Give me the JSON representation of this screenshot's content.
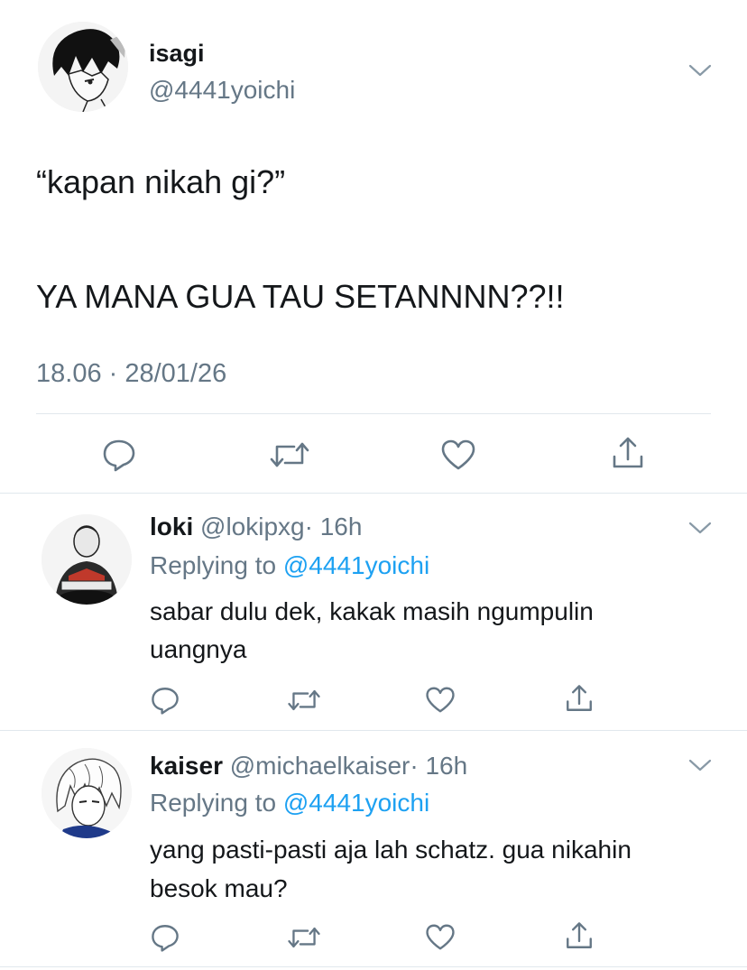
{
  "main_tweet": {
    "display_name": "isagi",
    "handle": "@4441yoichi",
    "line1": "“kapan nikah gi?”",
    "line2": "YA MANA GUA TAU SETANNNN??!!",
    "timestamp": "18.06 · 28/01/26"
  },
  "replies": [
    {
      "display_name": "loki",
      "handle": "@lokipxg",
      "time": "· 16h",
      "replying_prefix": "Replying to",
      "replying_handle": "@4441yoichi",
      "text_line1": "sabar dulu dek, kakak masih ngumpulin",
      "text_line2": "uangnya"
    },
    {
      "display_name": "kaiser",
      "handle": "@michaelkaiser",
      "time": "· 16h",
      "replying_prefix": "Replying to",
      "replying_handle": "@4441yoichi",
      "text_line1": "yang pasti-pasti aja lah schatz. gua nikahin",
      "text_line2": "besok mau?"
    }
  ],
  "colors": {
    "text": "#14171a",
    "secondary": "#657786",
    "link": "#1da1f2",
    "divider": "#e1e8ed"
  },
  "icons": [
    "chevron-down-icon",
    "reply-icon",
    "retweet-icon",
    "like-icon",
    "share-icon"
  ]
}
